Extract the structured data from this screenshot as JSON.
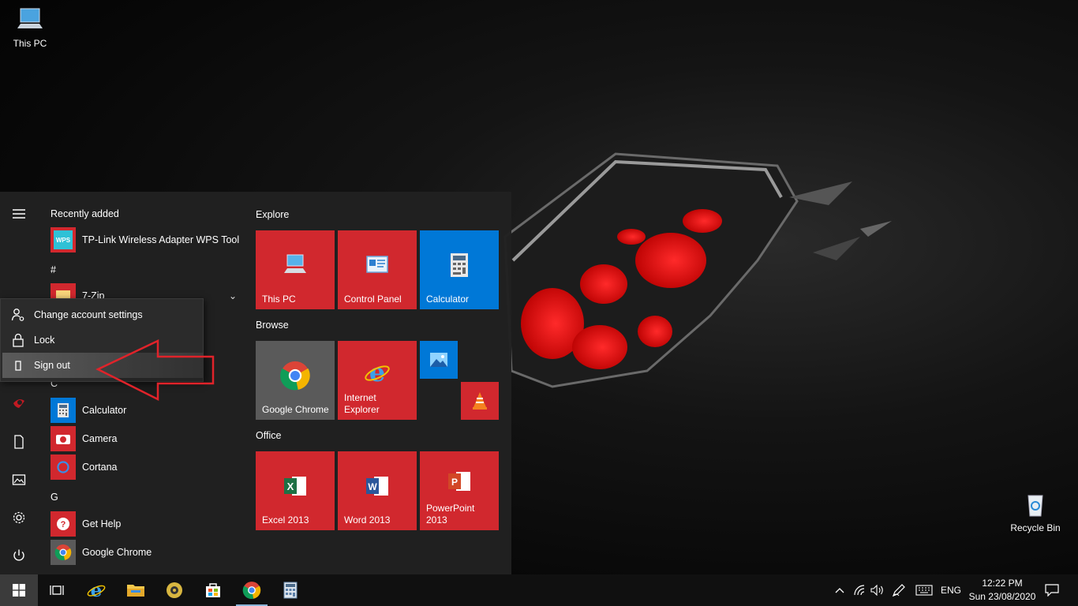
{
  "desktop": {
    "icons": [
      {
        "label": "This PC",
        "icon": "this-pc-icon"
      },
      {
        "label": "Recycle Bin",
        "icon": "recycle-bin-icon"
      }
    ]
  },
  "start_menu": {
    "recently_added_label": "Recently added",
    "recent_app": "TP-Link Wireless Adapter WPS Tool",
    "letters": {
      "hash": "#",
      "c": "C",
      "g": "G"
    },
    "partially_hidden_app": "7-Zip",
    "apps": [
      {
        "label": "Calculator",
        "icon": "calculator-icon"
      },
      {
        "label": "Camera",
        "icon": "camera-icon"
      },
      {
        "label": "Cortana",
        "icon": "cortana-icon"
      },
      {
        "label": "Get Help",
        "icon": "get-help-icon"
      },
      {
        "label": "Google Chrome",
        "icon": "chrome-icon"
      }
    ],
    "tile_groups": {
      "explore": "Explore",
      "browse": "Browse",
      "office": "Office"
    },
    "tiles": {
      "this_pc": "This PC",
      "control_panel": "Control Panel",
      "calculator": "Calculator",
      "chrome": "Google Chrome",
      "ie": "Internet Explorer",
      "excel": "Excel 2013",
      "word": "Word 2013",
      "powerpoint": "PowerPoint 2013"
    },
    "account_flyout": {
      "change_settings": "Change account settings",
      "lock": "Lock",
      "sign_out": "Sign out"
    }
  },
  "taskbar": {
    "language": "ENG",
    "time": "12:22 PM",
    "date": "Sun 23/08/2020"
  },
  "colors": {
    "tile_red": "#d1282e",
    "tile_blue": "#0078d7",
    "tile_gray": "#5a5a5a",
    "annotation_red": "#e0232a"
  }
}
